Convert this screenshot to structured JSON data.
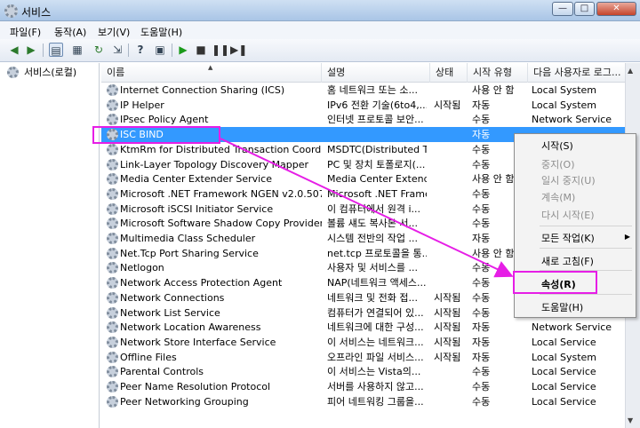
{
  "window": {
    "title": "서비스",
    "buttons": [
      "—",
      "□",
      "✕"
    ]
  },
  "menu": [
    "파일(F)",
    "동작(A)",
    "보기(V)",
    "도움말(H)"
  ],
  "toolbar": {
    "icons": [
      "back-icon",
      "forward-icon",
      "show-tree-icon",
      "properties-icon",
      "refresh-icon",
      "export-icon",
      "help-icon",
      "view-icon",
      "start-icon",
      "stop-icon",
      "pause-icon",
      "restart-icon"
    ]
  },
  "tree": {
    "root_label": "서비스(로컬)"
  },
  "columns": {
    "name": "이름",
    "description": "설명",
    "status": "상태",
    "startup": "시작 유형",
    "logon": "다음 사용자로 로그..."
  },
  "services": [
    {
      "name": "Internet Connection Sharing (ICS)",
      "description": "홈 네트워크 또는 소...",
      "status": "",
      "startup": "사용 안 함",
      "logon": "Local System"
    },
    {
      "name": "IP Helper",
      "description": "IPv6 전환 기술(6to4,...",
      "status": "시작됨",
      "startup": "자동",
      "logon": "Local System"
    },
    {
      "name": "IPsec Policy Agent",
      "description": "인터넷 프로토콜 보안...",
      "status": "",
      "startup": "수동",
      "logon": "Network Service"
    },
    {
      "name": "ISC BIND",
      "description": "",
      "status": "",
      "startup": "자동",
      "logon": ""
    },
    {
      "name": "KtmRm for Distributed Transaction Coordinator",
      "description": "MSDTC(Distributed T...",
      "status": "",
      "startup": "수동",
      "logon": ""
    },
    {
      "name": "Link-Layer Topology Discovery Mapper",
      "description": "PC 및 장치 토폴로지(...",
      "status": "",
      "startup": "수동",
      "logon": ""
    },
    {
      "name": "Media Center Extender Service",
      "description": "Media Center Extend...",
      "status": "",
      "startup": "사용 안 함",
      "logon": ""
    },
    {
      "name": "Microsoft .NET Framework NGEN v2.0.50727_...",
      "description": "Microsoft .NET Frame...",
      "status": "",
      "startup": "수동",
      "logon": ""
    },
    {
      "name": "Microsoft iSCSI Initiator Service",
      "description": "이 컴퓨터에서 원격 i...",
      "status": "",
      "startup": "수동",
      "logon": ""
    },
    {
      "name": "Microsoft Software Shadow Copy Provider",
      "description": "볼륨 섀도 복사본 서...",
      "status": "",
      "startup": "수동",
      "logon": ""
    },
    {
      "name": "Multimedia Class Scheduler",
      "description": "시스템 전반의 작업 ...",
      "status": "",
      "startup": "자동",
      "logon": ""
    },
    {
      "name": "Net.Tcp Port Sharing Service",
      "description": "net.tcp 프로토콜을 통...",
      "status": "",
      "startup": "사용 안 함",
      "logon": ""
    },
    {
      "name": "Netlogon",
      "description": "사용자 및 서비스를 ...",
      "status": "",
      "startup": "수동",
      "logon": ""
    },
    {
      "name": "Network Access Protection Agent",
      "description": "NAP(네트워크 액세스...",
      "status": "",
      "startup": "수동",
      "logon": ""
    },
    {
      "name": "Network Connections",
      "description": "네트워크 및 전화 접...",
      "status": "시작됨",
      "startup": "수동",
      "logon": ""
    },
    {
      "name": "Network List Service",
      "description": "컴퓨터가 연결되어 있...",
      "status": "시작됨",
      "startup": "수동",
      "logon": ""
    },
    {
      "name": "Network Location Awareness",
      "description": "네트워크에 대한 구성...",
      "status": "시작됨",
      "startup": "자동",
      "logon": "Network Service"
    },
    {
      "name": "Network Store Interface Service",
      "description": "이 서비스는 네트워크...",
      "status": "시작됨",
      "startup": "자동",
      "logon": "Local Service"
    },
    {
      "name": "Offline Files",
      "description": "오프라인 파일 서비스...",
      "status": "시작됨",
      "startup": "자동",
      "logon": "Local System"
    },
    {
      "name": "Parental Controls",
      "description": "이 서비스는 Vista의...",
      "status": "",
      "startup": "수동",
      "logon": "Local Service"
    },
    {
      "name": "Peer Name Resolution Protocol",
      "description": "서버를 사용하지 않고...",
      "status": "",
      "startup": "수동",
      "logon": "Local Service"
    },
    {
      "name": "Peer Networking Grouping",
      "description": "피어 네트워킹 그룹을...",
      "status": "",
      "startup": "수동",
      "logon": "Local Service"
    }
  ],
  "selected_row": 3,
  "context_menu": {
    "start": "시작(S)",
    "stop": "중지(O)",
    "pause": "일시 중지(U)",
    "resume": "계속(M)",
    "restart": "다시 시작(E)",
    "all_tasks": "모든 작업(K)",
    "refresh": "새로 고침(F)",
    "properties": "속성(R)",
    "help": "도움말(H)"
  },
  "annotation_color": "#e61ee6"
}
